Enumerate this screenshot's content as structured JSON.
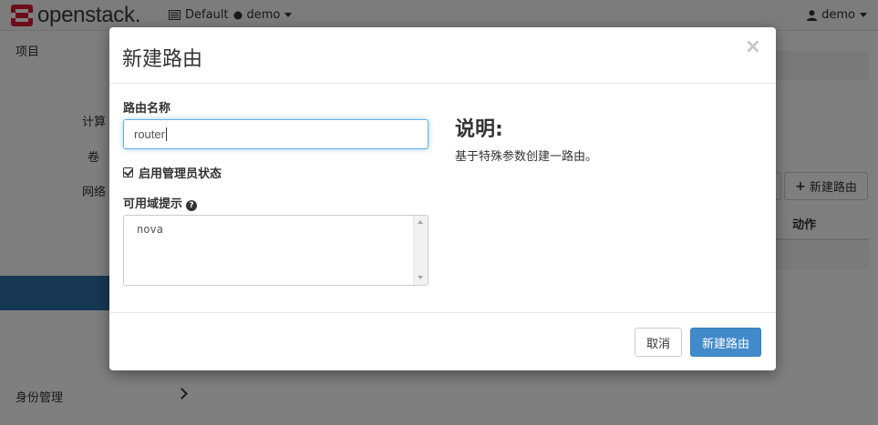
{
  "topbar": {
    "logo_text": "openstack.",
    "domain": "Default",
    "project": "demo",
    "user": "demo"
  },
  "sidebar": {
    "project_label": "项目",
    "compute_label": "计算",
    "volume_label": "卷",
    "network_label": "网络",
    "identity_label": "身份管理"
  },
  "main": {
    "create_router_button": "新建路由",
    "actions_header": "动作"
  },
  "modal": {
    "title": "新建路由",
    "close_symbol": "×",
    "router_name_label": "路由名称",
    "router_name_value": "router",
    "admin_state_label": "启用管理员状态",
    "admin_state_checked": true,
    "az_hint_label": "可用域提示",
    "az_options": [
      "nova"
    ],
    "description_title": "说明:",
    "description_text": "基于特殊参数创建一路由。",
    "cancel_button": "取消",
    "submit_button": "新建路由"
  },
  "colors": {
    "primary": "#428bca",
    "logo_red": "#da1a32",
    "sidebar_active": "#2f6fa7",
    "focus_border": "#66afe9"
  }
}
